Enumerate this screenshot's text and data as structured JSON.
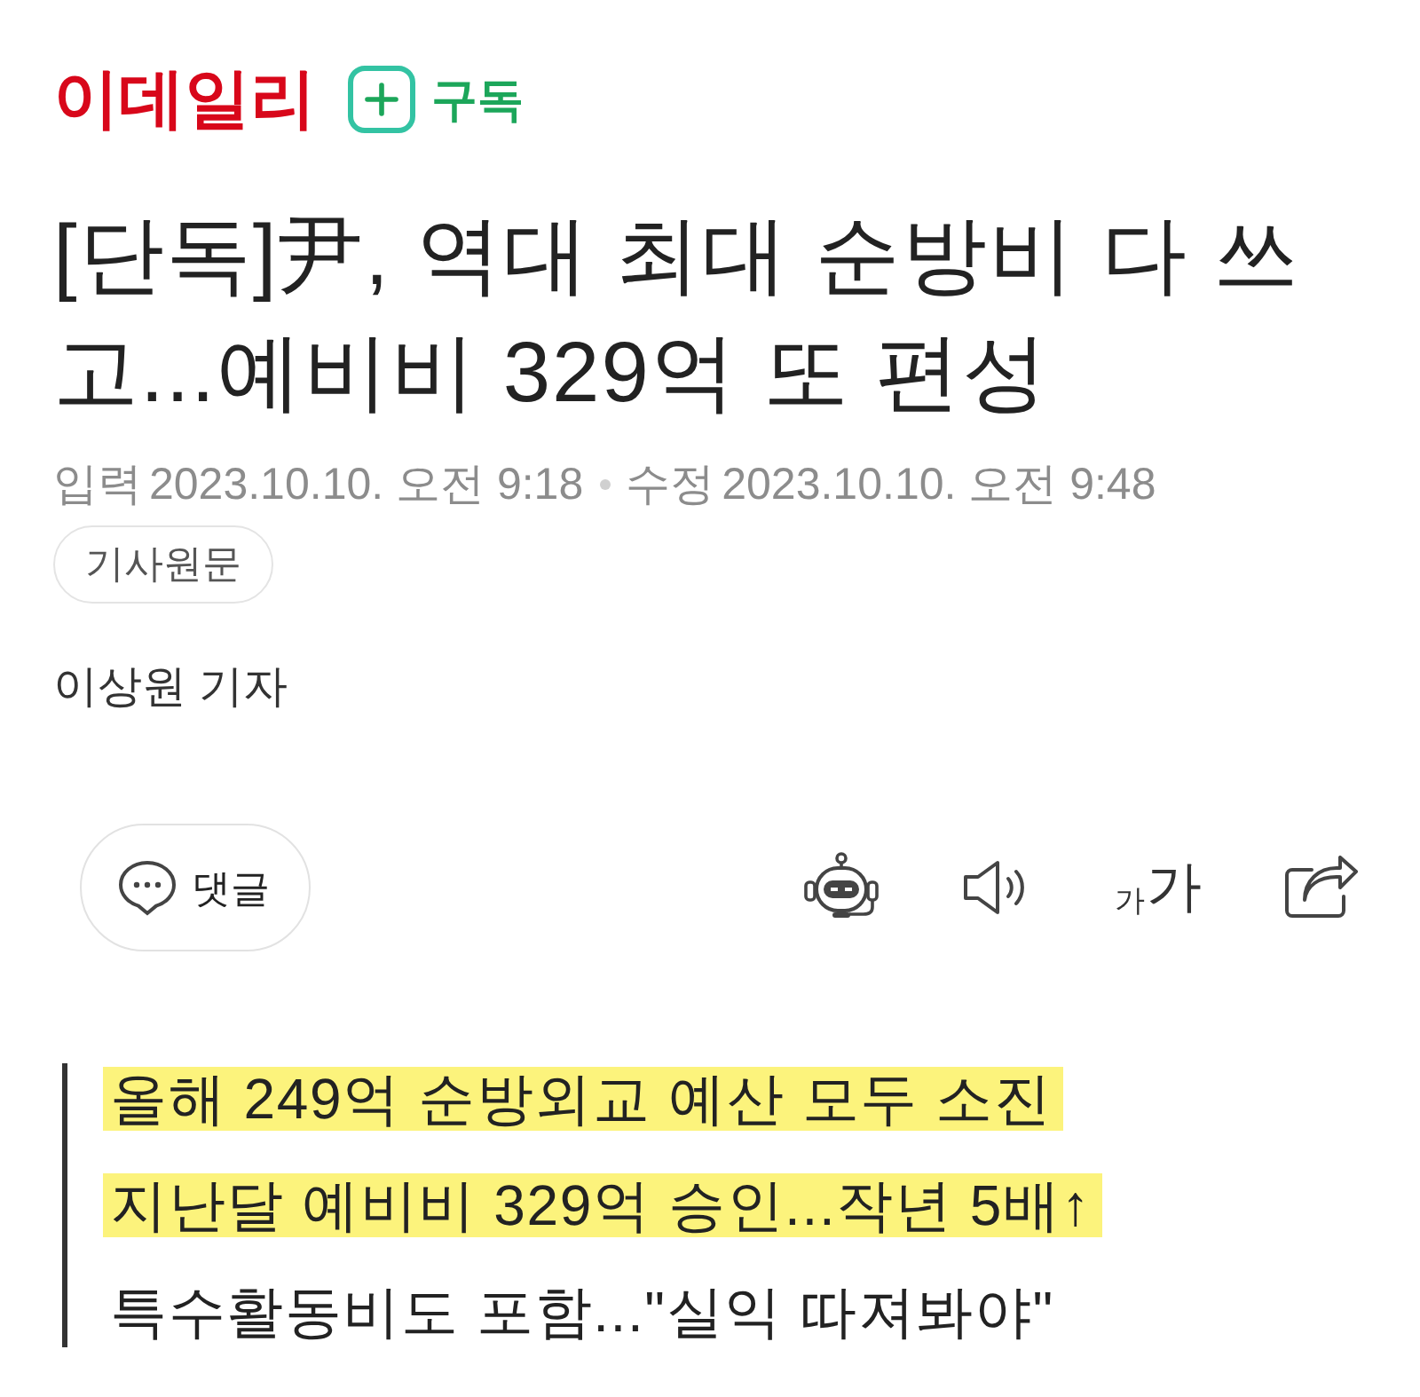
{
  "header": {
    "logo": "이데일리",
    "subscribe": {
      "label": "구독"
    }
  },
  "article": {
    "title": "[단독]尹, 역대 최대 순방비 다 쓰고...예비비 329억 또 편성",
    "timestamps": [
      {
        "label": "입력",
        "time": "2023.10.10. 오전 9:18"
      },
      {
        "label": "수정",
        "time": "2023.10.10. 오전 9:48"
      }
    ],
    "original_button": "기사원문",
    "reporter": "이상원 기자"
  },
  "actions": {
    "comment_button": "댓글",
    "tools": [
      {
        "kind": "robot"
      },
      {
        "kind": "speaker"
      },
      {
        "kind": "font_size",
        "small": "가",
        "large": "가"
      },
      {
        "kind": "share"
      }
    ]
  },
  "summary": [
    {
      "text": "올해 249억 순방외교 예산 모두 소진",
      "highlighted": true
    },
    {
      "text": "지난달 예비비 329억 승인...작년 5배↑",
      "highlighted": true
    },
    {
      "text": "특수활동비도 포함...\"실익 따져봐야\"",
      "highlighted": false
    }
  ]
}
